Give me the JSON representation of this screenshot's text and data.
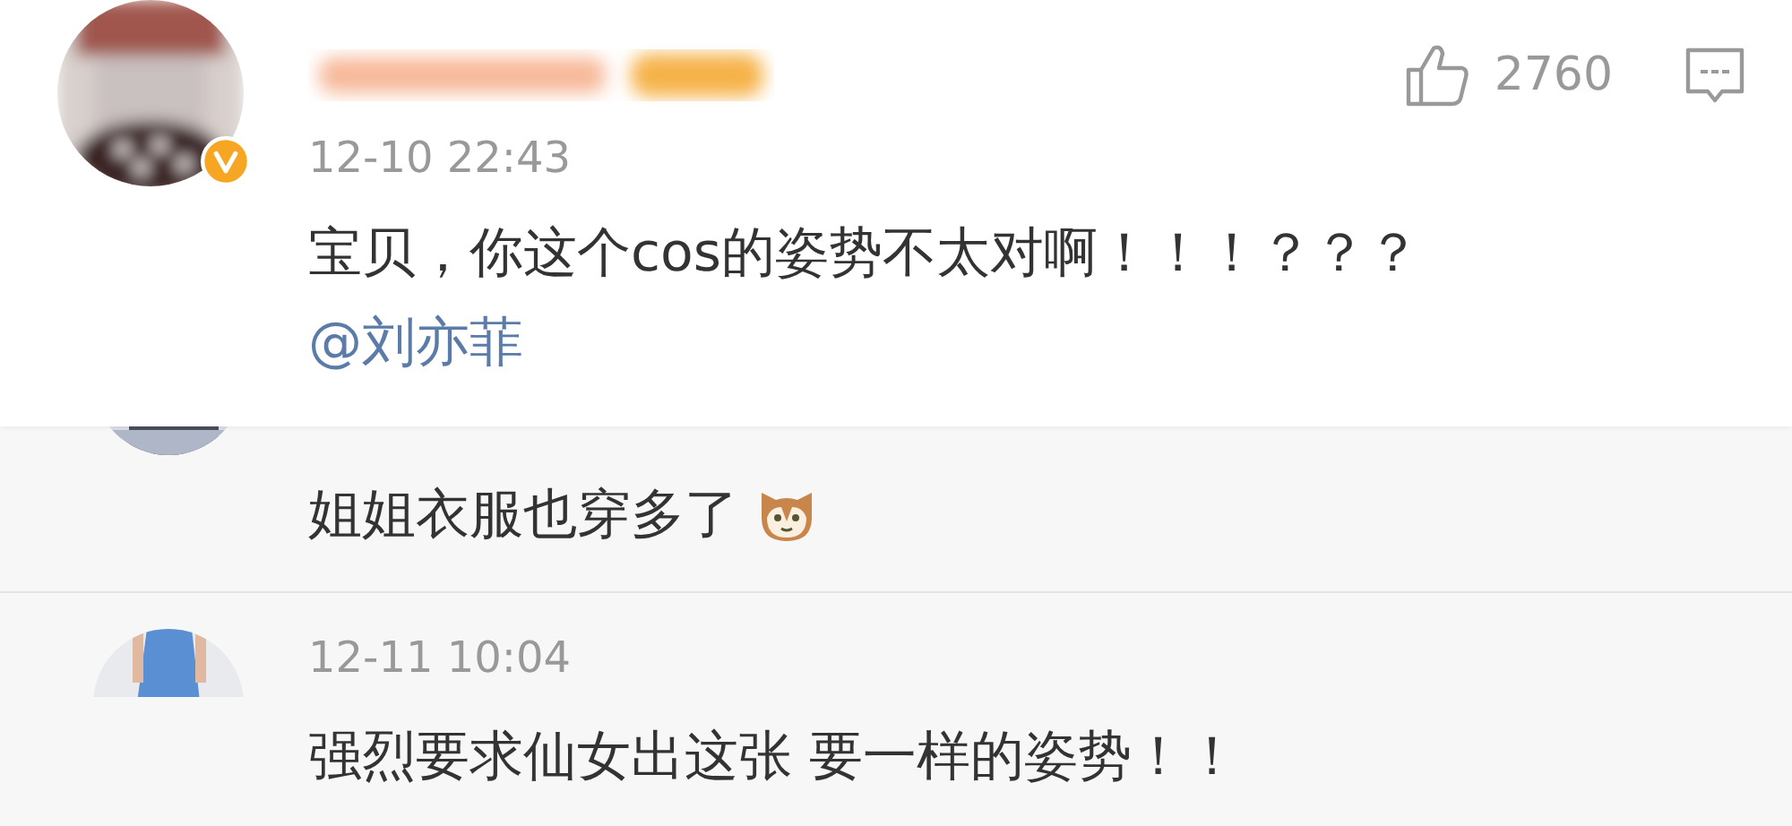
{
  "pinned_comment": {
    "verified": true,
    "timestamp": "12-10 22:43",
    "likes": "2760",
    "text": "宝贝，你这个cos的姿势不太对啊！！！？？？",
    "mention": "@刘亦菲"
  },
  "replies": [
    {
      "text": "姐姐衣服也穿多了",
      "emoji": true
    },
    {
      "timestamp": "12-11 10:04",
      "text": "强烈要求仙女出这张 要一样的姿势！！"
    }
  ]
}
